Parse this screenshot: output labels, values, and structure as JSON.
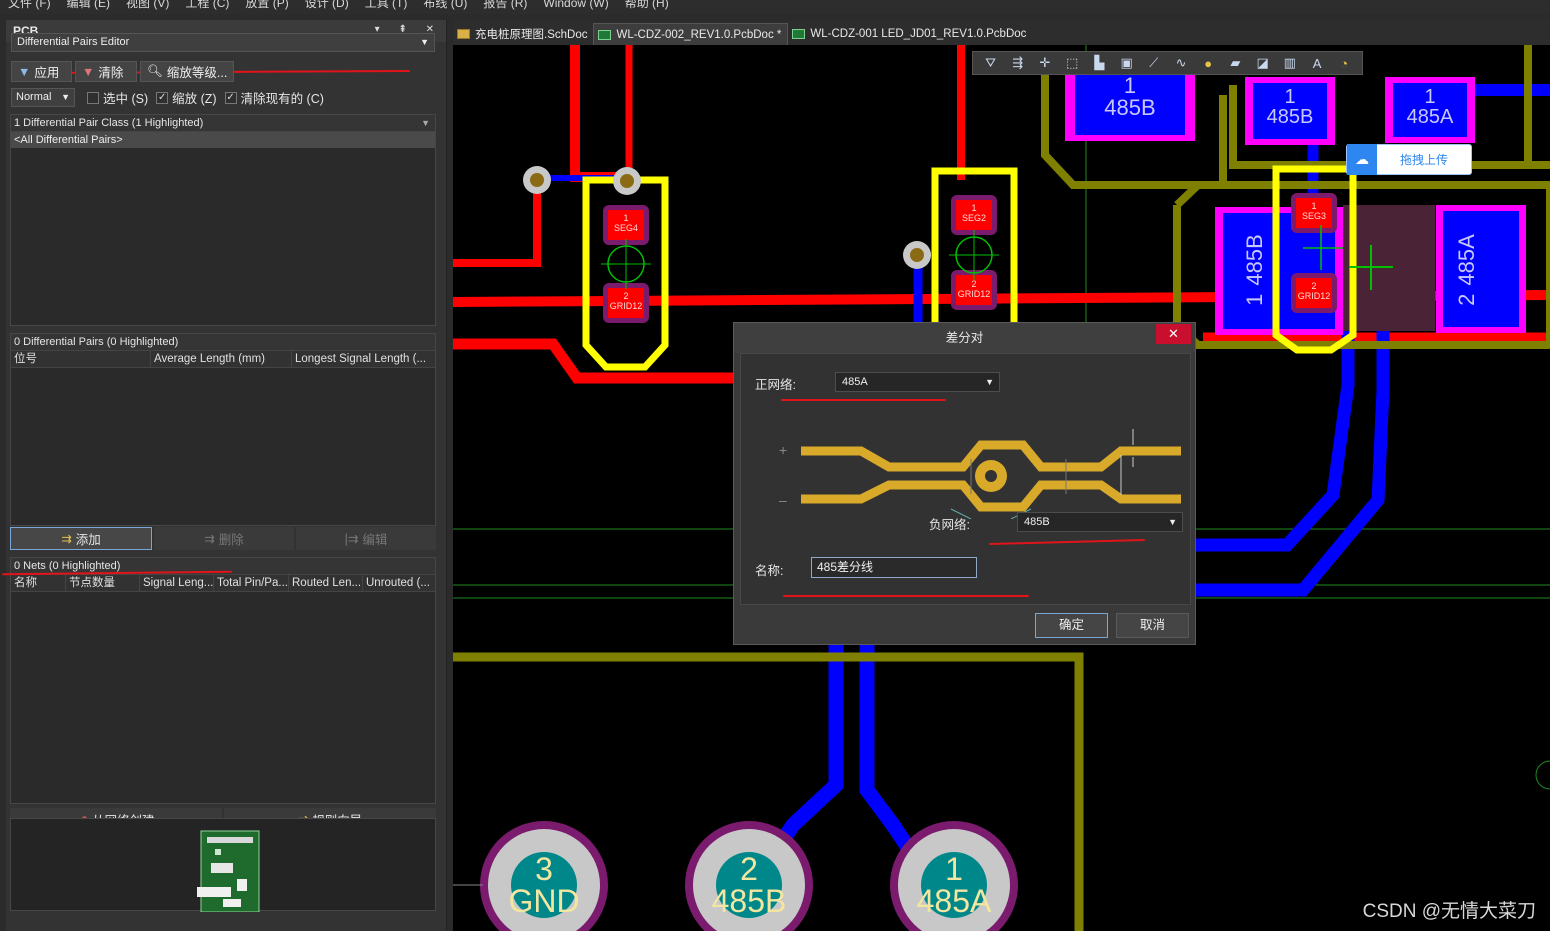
{
  "menu": [
    "文件 (F)",
    "编辑 (E)",
    "视图 (V)",
    "工程 (C)",
    "放置 (P)",
    "设计 (D)",
    "工具 (T)",
    "布线 (U)",
    "报告 (R)",
    "Window (W)",
    "帮助 (H)"
  ],
  "panel": {
    "title": "PCB",
    "mode": "Differential Pairs Editor",
    "buttons": {
      "apply": "应用",
      "clear": "清除",
      "zoom": "缩放等级..."
    },
    "view_mode": "Normal",
    "checks": [
      {
        "label": "选中 (S)",
        "checked": false
      },
      {
        "label": "缩放 (Z)",
        "checked": true
      },
      {
        "label": "清除现有的 (C)",
        "checked": true
      }
    ],
    "classes_header": "1 Differential Pair Class (1 Highlighted)",
    "classes_row": "<All Differential Pairs>",
    "pairs_header": "0 Differential Pairs (0 Highlighted)",
    "pairs_cols": [
      "位号",
      "Average Length (mm)",
      "Longest Signal Length (..."
    ],
    "pair_actions": {
      "add": "添加",
      "delete": "删除",
      "edit": "编辑"
    },
    "nets_header": "0 Nets (0 Highlighted)",
    "nets_cols": [
      "名称",
      "节点数量",
      "Signal Leng...",
      "Total Pin/Pa...",
      "Routed Len...",
      "Unrouted (..."
    ],
    "bottom_actions": {
      "from_nets": "从网络创建",
      "rule_wizard": "规则向导"
    }
  },
  "tabs": [
    {
      "label": "充电桩原理图.SchDoc",
      "type": "sch",
      "active": false
    },
    {
      "label": "WL-CDZ-002_REV1.0.PcbDoc *",
      "type": "pcb",
      "active": true
    },
    {
      "label": "WL-CDZ-001 LED_JD01_REV1.0.PcbDoc",
      "type": "pcb",
      "active": false
    }
  ],
  "canvas": {
    "pads": {
      "seg4_top": "1",
      "seg4_top_net": "SEG4",
      "seg4_bot": "2",
      "seg4_bot_net": "GRID12",
      "seg2_top": "1",
      "seg2_top_net": "SEG2",
      "seg2_bot": "2",
      "seg2_bot_net": "GRID12",
      "seg3_top": "1",
      "seg3_top_net": "SEG3",
      "seg3_bot": "2",
      "seg3_bot_net": "GRID12"
    },
    "smd": [
      {
        "num": "1",
        "net": "485B"
      },
      {
        "num": "1",
        "net": "485B"
      },
      {
        "num": "1",
        "net": "485A"
      }
    ],
    "big_pads": [
      {
        "num": "1",
        "net": "485B"
      },
      {
        "num": "2",
        "net": "485A"
      }
    ],
    "connectors": [
      {
        "num": "3",
        "net": "GND"
      },
      {
        "num": "2",
        "net": "485B"
      },
      {
        "num": "1",
        "net": "485A"
      }
    ],
    "upload_badge": "拖拽上传"
  },
  "dialog": {
    "title": "差分对",
    "close": "✕",
    "positive_label": "正网络:",
    "positive_value": "485A",
    "negative_label": "负网络:",
    "negative_value": "485B",
    "name_label": "名称:",
    "name_value": "485差分线",
    "ok": "确定",
    "cancel": "取消",
    "plus": "+",
    "minus": "–"
  },
  "watermark": "CSDN @无情大菜刀",
  "colors": {
    "red_track": "#ff0000",
    "blue_track": "#0000ff",
    "yellow_outline": "#ffff00",
    "olive_outline": "#808000",
    "magenta_pad": "#ff00ff",
    "pad_teal": "#00878a"
  }
}
